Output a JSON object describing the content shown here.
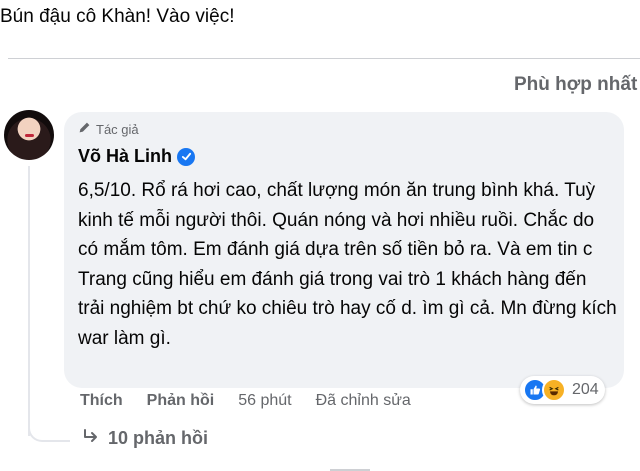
{
  "post": {
    "text": "Bún đậu cô Khàn! Vào việc!"
  },
  "comments_header": {
    "sort_label": "Phù hợp nhất"
  },
  "comment": {
    "author_badge": "Tác giả",
    "author_name": "Võ Hà Linh",
    "body": "6,5/10. Rổ rá hơi cao, chất lượng món ăn trung bình khá. Tuỳ kinh tế mỗi người thôi. Quán nóng và hơi nhiều ruồi. Chắc do có mắm tôm. Em đánh giá dựa trên số tiền bỏ ra. Và em tin c Trang cũng hiểu em đánh giá trong vai trò 1 khách hàng đến trải nghiệm bt chứ ko chiêu trò hay cố d. ìm gì cả. Mn đừng kích war làm gì.",
    "reaction_count": "204",
    "reactions": [
      "like-icon",
      "haha-icon"
    ],
    "actions": {
      "like": "Thích",
      "reply": "Phản hồi",
      "time": "56 phút",
      "edited": "Đã chỉnh sửa"
    },
    "replies_label": "10 phản hồi"
  },
  "colors": {
    "accent": "#1877f2",
    "muted": "#65676b",
    "bubble": "#f0f2f5",
    "haha": "#f7b125"
  }
}
